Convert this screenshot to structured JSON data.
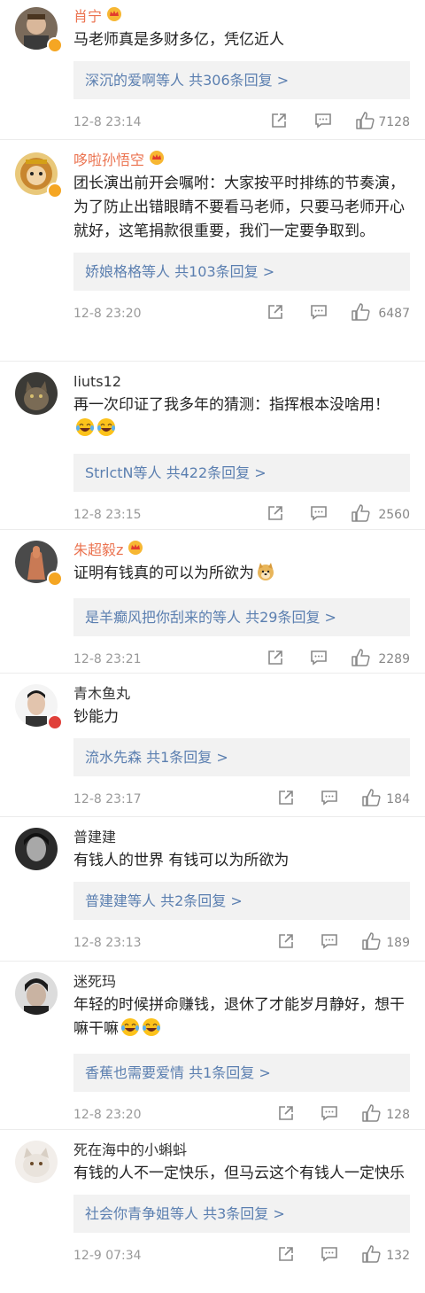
{
  "comments": [
    {
      "name": "肖宁",
      "content": "马老师真是多财多亿，凭亿近人",
      "replies": "深沉的爱啊等人  共306条回复 >",
      "time": "12-8 23:14",
      "likes": "7128"
    },
    {
      "name": "哆啦孙悟空",
      "content": "团长演出前开会嘱咐：大家按平时排练的节奏演，为了防止出错眼睛不要看马老师，只要马老师开心就好，这笔捐款很重要，我们一定要争取到。",
      "replies": "娇娘格格等人  共103条回复 >",
      "time": "12-8 23:20",
      "likes": "6487"
    },
    {
      "name": "liuts12",
      "content": "再一次印证了我多年的猜测：指挥根本没啥用！",
      "replies": "StrlctN等人  共422条回复 >",
      "time": "12-8 23:15",
      "likes": "2560"
    },
    {
      "name": "朱超毅z",
      "content": "证明有钱真的可以为所欲为",
      "replies": "是羊癫风把你刮来的等人  共29条回复 >",
      "time": "12-8 23:21",
      "likes": "2289"
    },
    {
      "name": "青木鱼丸",
      "content": "钞能力",
      "replies": "流水先森  共1条回复 >",
      "time": "12-8 23:17",
      "likes": "184"
    },
    {
      "name": "普建建",
      "content": "有钱人的世界  有钱可以为所欲为",
      "replies": "普建建等人  共2条回复 >",
      "time": "12-8 23:13",
      "likes": "189"
    },
    {
      "name": "迷死玛",
      "content": "年轻的时候拼命赚钱，退休了才能岁月静好，想干嘛干嘛",
      "replies": "香蕉也需要爱情  共1条回复 >",
      "time": "12-8 23:20",
      "likes": "128"
    },
    {
      "name": "死在海中的小蝌蚪",
      "content": "有钱的人不一定快乐，但马云这个有钱人一定快乐",
      "replies": "社会你青争姐等人  共3条回复 >",
      "time": "12-9 07:34",
      "likes": "132"
    }
  ],
  "icons": {
    "share": "share-icon",
    "comment": "comment-icon",
    "like": "thumbs-up-icon",
    "crown": "vip-crown-icon",
    "laugh": "laughing-tears-emoji",
    "doge": "doge-emoji"
  },
  "colors": {
    "vip_name": "#eb7350",
    "link": "#5b7fb0",
    "meta": "#999999",
    "reply_bg": "#f2f2f2"
  }
}
